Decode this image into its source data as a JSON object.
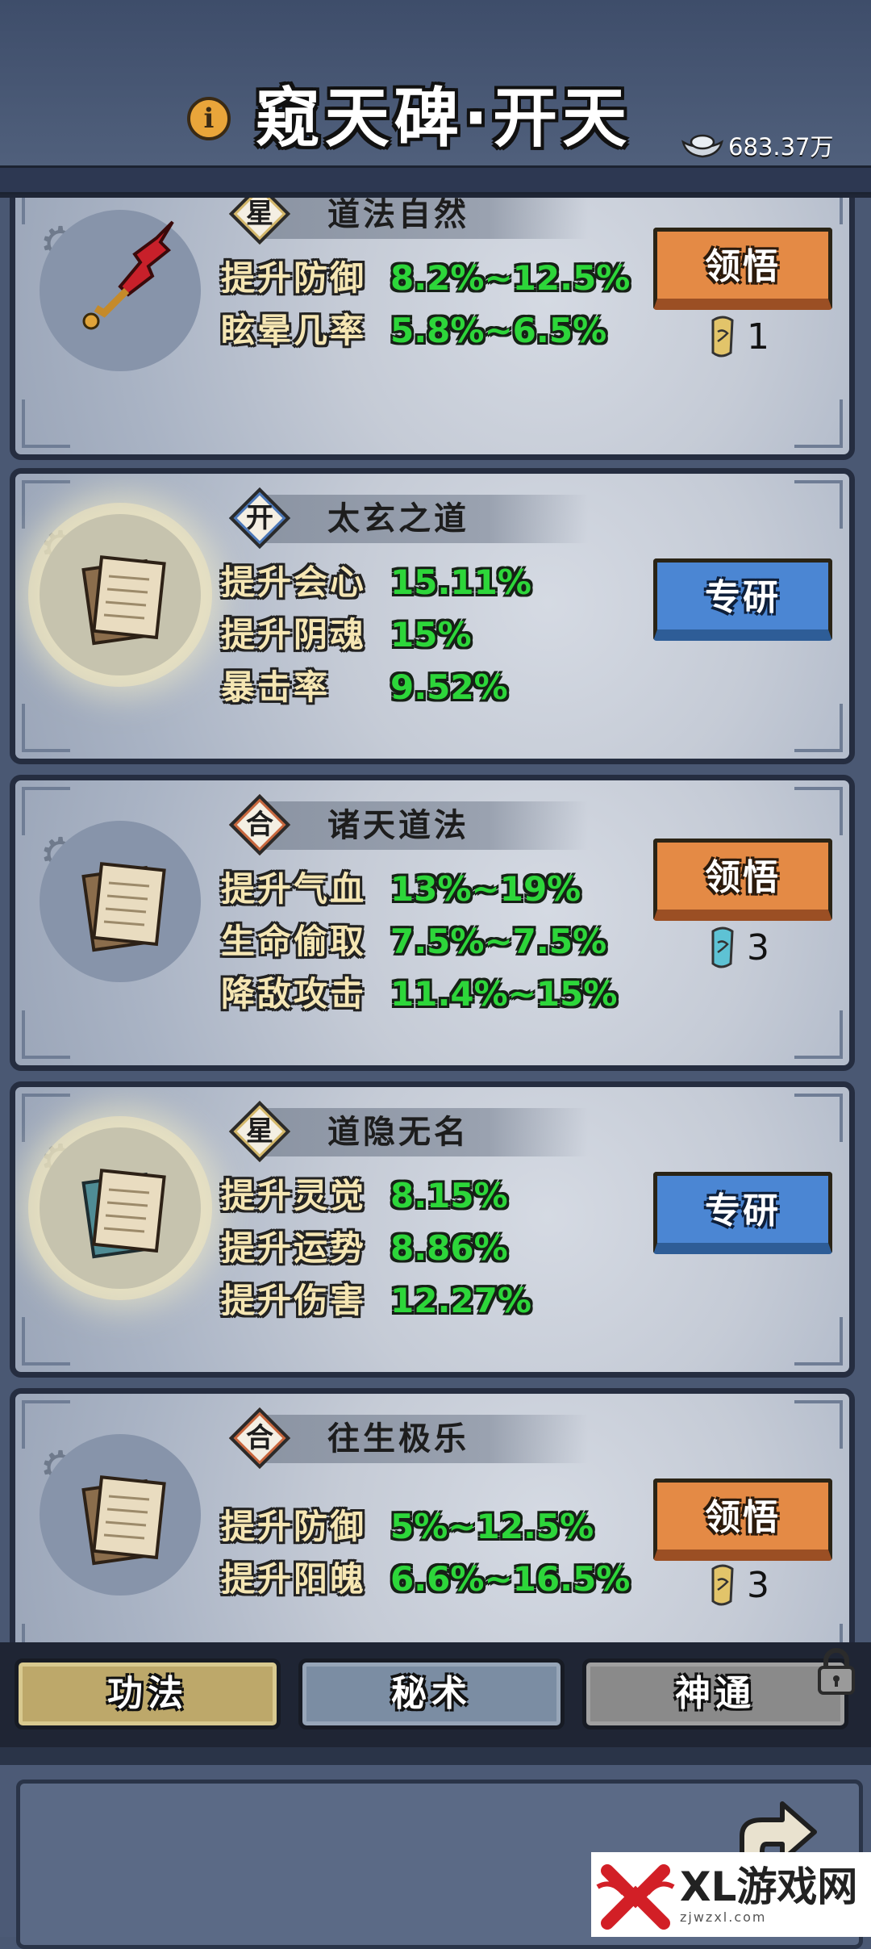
{
  "header": {
    "title": "窥天碑·开天",
    "info_icon": "info-icon",
    "currency": "683.37万",
    "currency_icon": "silver-ingot-icon"
  },
  "cards": [
    {
      "tag": "星",
      "tag_type": "star",
      "name": "道法自然",
      "icon": "red-sword-icon",
      "stats": [
        {
          "label": "提升防御",
          "value": "8.2%~12.5%"
        },
        {
          "label": "眩晕几率",
          "value": "5.8%~6.5%"
        }
      ],
      "button": "领悟",
      "button_type": "orange",
      "cost": "1",
      "cost_icon": "yellow-scroll-icon"
    },
    {
      "tag": "开",
      "tag_type": "kai",
      "name": "太玄之道",
      "icon": "scroll-pages-icon",
      "stats": [
        {
          "label": "提升会心",
          "value": "15.11%"
        },
        {
          "label": "提升阴魂",
          "value": "15%"
        },
        {
          "label": "暴击率",
          "value": "9.52%"
        }
      ],
      "button": "专研",
      "button_type": "blue"
    },
    {
      "tag": "合",
      "tag_type": "he",
      "name": "诸天道法",
      "icon": "scroll-pages-icon",
      "stats": [
        {
          "label": "提升气血",
          "value": "13%~19%"
        },
        {
          "label": "生命偷取",
          "value": "7.5%~7.5%"
        },
        {
          "label": "降敌攻击",
          "value": "11.4%~15%"
        }
      ],
      "button": "领悟",
      "button_type": "orange",
      "cost": "3",
      "cost_icon": "blue-scroll-icon"
    },
    {
      "tag": "星",
      "tag_type": "star",
      "name": "道隐无名",
      "icon": "scroll-pages-icon",
      "stats": [
        {
          "label": "提升灵觉",
          "value": "8.15%"
        },
        {
          "label": "提升运势",
          "value": "8.86%"
        },
        {
          "label": "提升伤害",
          "value": "12.27%"
        }
      ],
      "button": "专研",
      "button_type": "blue"
    },
    {
      "tag": "合",
      "tag_type": "he",
      "name": "往生极乐",
      "icon": "scroll-pages-icon",
      "stats": [
        {
          "label": "提升防御",
          "value": "5%~12.5%"
        },
        {
          "label": "提升阳魄",
          "value": "6.6%~16.5%"
        }
      ],
      "button": "领悟",
      "button_type": "orange",
      "cost": "3",
      "cost_icon": "yellow-scroll-icon"
    }
  ],
  "tabs": [
    {
      "label": "功法",
      "state": "selected"
    },
    {
      "label": "秘术",
      "state": "normal"
    },
    {
      "label": "神通",
      "state": "locked"
    }
  ],
  "watermark": {
    "brand": "XL游戏网",
    "url": "zjwzxl.com"
  }
}
